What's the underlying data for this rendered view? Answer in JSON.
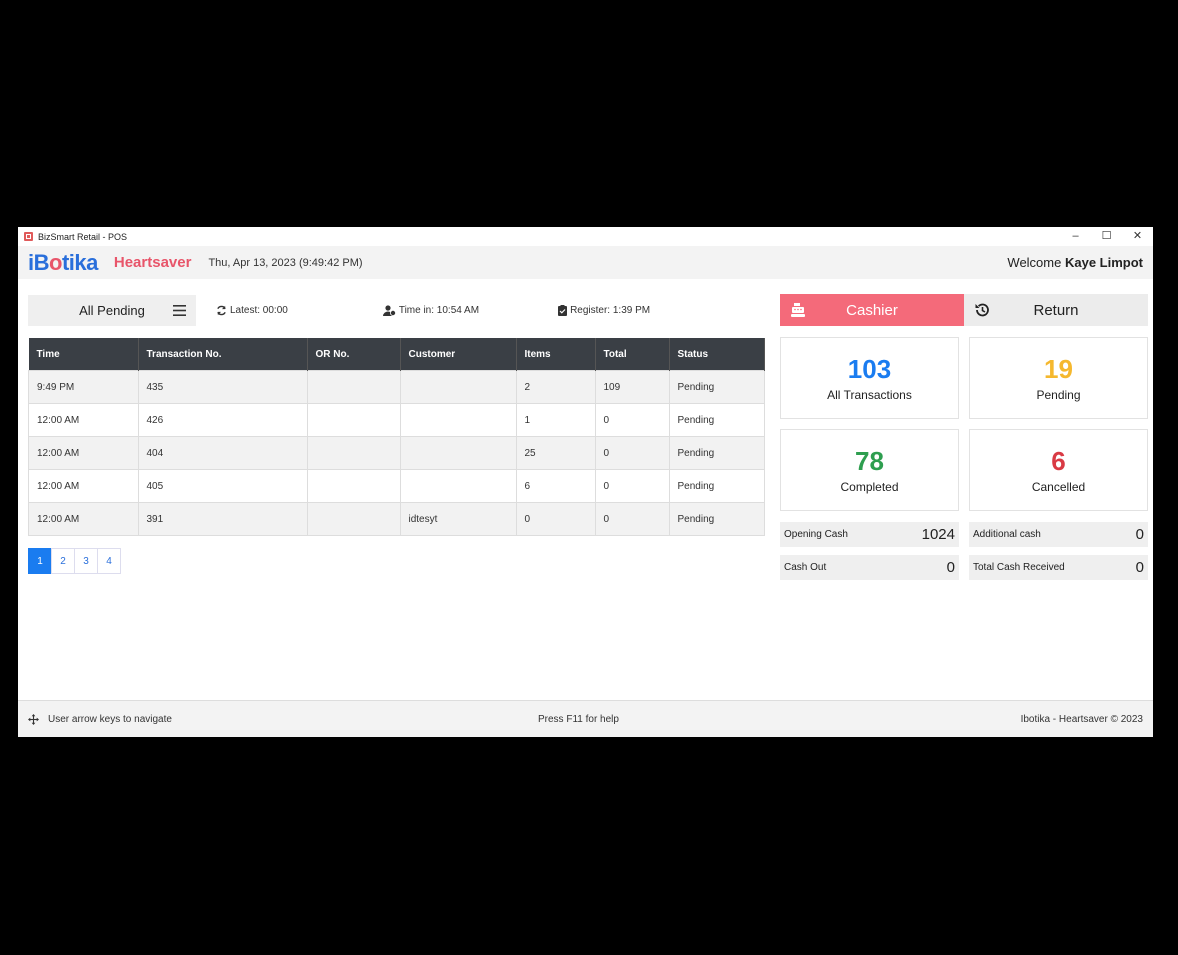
{
  "window": {
    "title": "BizSmart Retail - POS",
    "minimize": "–",
    "maximize": "☐",
    "close": "✕"
  },
  "header": {
    "logo_prefix": "iB",
    "logo_mid": "o",
    "logo_suffix": "tika",
    "brand": "Heartsaver",
    "date": "Thu, Apr 13, 2023 (9:49:42 PM)",
    "welcome_prefix": "Welcome",
    "user": "Kaye Limpot"
  },
  "filter": {
    "label": "All Pending"
  },
  "info": {
    "latest": "Latest: 00:00",
    "time_in": "Time in: 10:54 AM",
    "register": "Register: 1:39 PM"
  },
  "table": {
    "headers": [
      "Time",
      "Transaction No.",
      "OR No.",
      "Customer",
      "Items",
      "Total",
      "Status"
    ],
    "rows": [
      [
        "9:49 PM",
        "435",
        "",
        "",
        "2",
        "109",
        "Pending"
      ],
      [
        "12:00 AM",
        "426",
        "",
        "",
        "1",
        "0",
        "Pending"
      ],
      [
        "12:00 AM",
        "404",
        "",
        "",
        "25",
        "0",
        "Pending"
      ],
      [
        "12:00 AM",
        "405",
        "",
        "",
        "6",
        "0",
        "Pending"
      ],
      [
        "12:00 AM",
        "391",
        "",
        "idtesyt",
        "0",
        "0",
        "Pending"
      ]
    ]
  },
  "pager": [
    "1",
    "2",
    "3",
    "4"
  ],
  "tabs": {
    "cashier": "Cashier",
    "return": "Return"
  },
  "stats": [
    {
      "value": "103",
      "label": "All Transactions",
      "color": "#1a7cf0"
    },
    {
      "value": "19",
      "label": "Pending",
      "color": "#f5b82e"
    },
    {
      "value": "78",
      "label": "Completed",
      "color": "#2e9e4f"
    },
    {
      "value": "6",
      "label": "Cancelled",
      "color": "#d93a44"
    }
  ],
  "cash": [
    {
      "label": "Opening Cash",
      "value": "1024"
    },
    {
      "label": "Additional cash",
      "value": "0"
    },
    {
      "label": "Cash Out",
      "value": "0"
    },
    {
      "label": "Total Cash Received",
      "value": "0"
    }
  ],
  "footer": {
    "nav_hint": "User arrow keys to navigate",
    "help": "Press F11 for help",
    "copyright": "Ibotika - Heartsaver © 2023"
  }
}
